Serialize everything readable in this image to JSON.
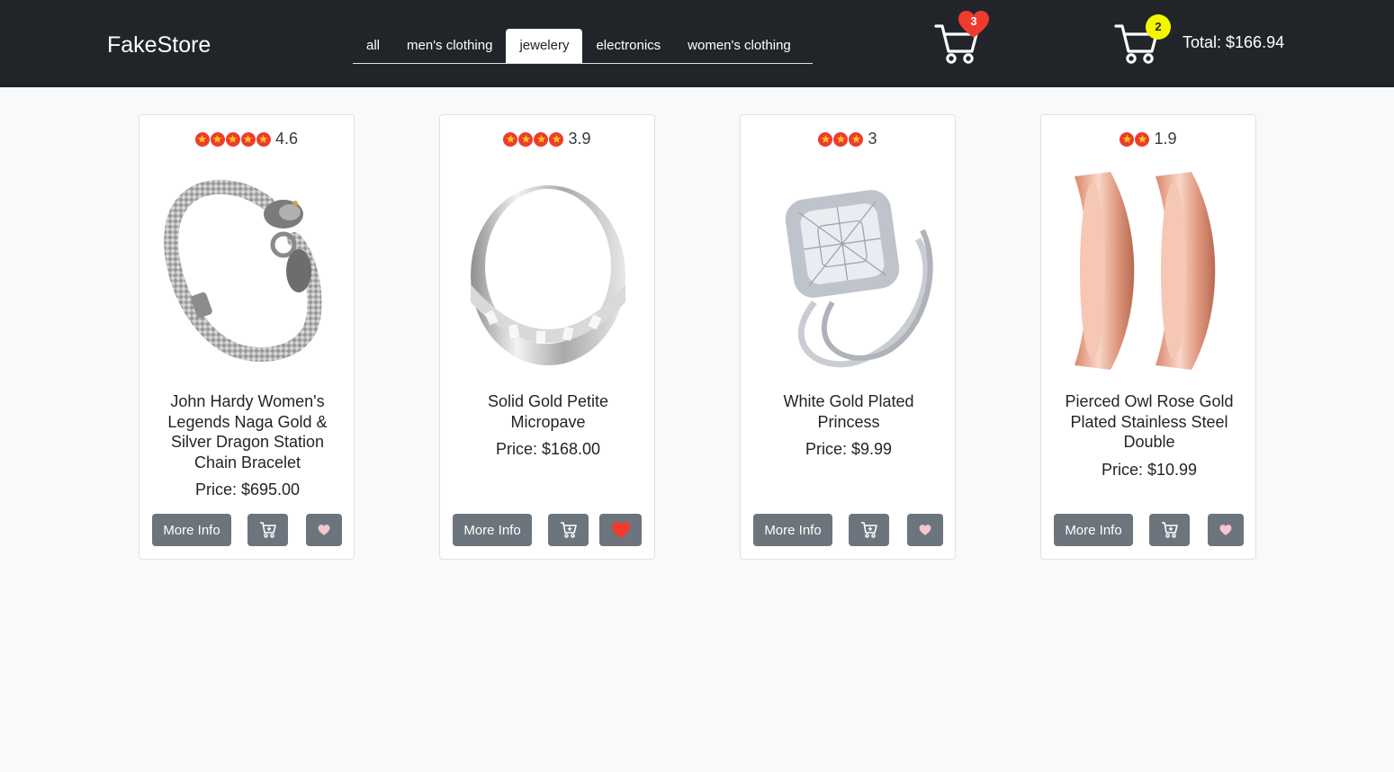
{
  "header": {
    "brand": "FakeStore",
    "tabs": [
      {
        "label": "all",
        "active": false
      },
      {
        "label": "men's clothing",
        "active": false
      },
      {
        "label": "jewelery",
        "active": true
      },
      {
        "label": "electronics",
        "active": false
      },
      {
        "label": "women's clothing",
        "active": false
      }
    ],
    "favorites_count": "3",
    "cart_count": "2",
    "cart_total": "Total: $166.94"
  },
  "products": [
    {
      "rating": "4.6",
      "stars": 5,
      "title": "John Hardy Women's Legends Naga Gold & Silver Dragon Station Chain Bracelet",
      "price": "Price: $695.00",
      "more_info": "More Info",
      "favorited": false,
      "image_icon": "bracelet-icon"
    },
    {
      "rating": "3.9",
      "stars": 4,
      "title": "Solid Gold Petite Micropave",
      "price": "Price: $168.00",
      "more_info": "More Info",
      "favorited": true,
      "image_icon": "silver-ring-icon"
    },
    {
      "rating": "3",
      "stars": 3,
      "title": "White Gold Plated Princess",
      "price": "Price: $9.99",
      "more_info": "More Info",
      "favorited": false,
      "image_icon": "diamond-ring-icon"
    },
    {
      "rating": "1.9",
      "stars": 2,
      "title": "Pierced Owl Rose Gold Plated Stainless Steel Double",
      "price": "Price: $10.99",
      "more_info": "More Info",
      "favorited": false,
      "image_icon": "rose-gold-tunnels-icon"
    }
  ],
  "colors": {
    "navbar": "#212529",
    "button": "#6c757d",
    "star": "#ef3b2d",
    "heart_on": "#ef3b2d",
    "heart_off": "#f7c6cf",
    "cart_badge": "#f5f500"
  }
}
